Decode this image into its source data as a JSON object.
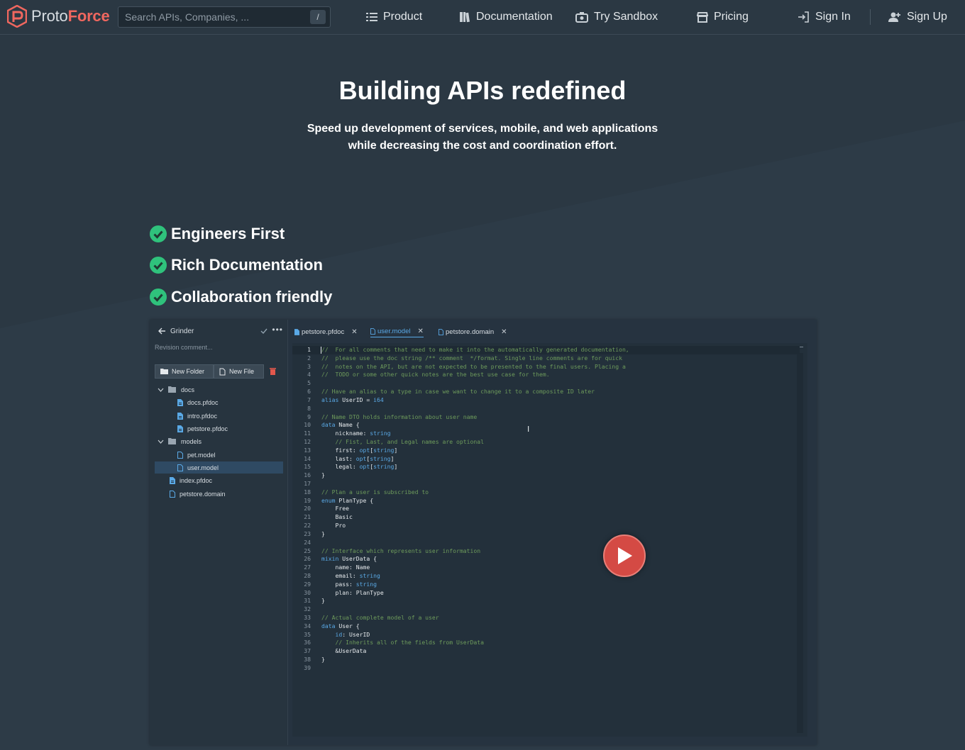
{
  "brand": {
    "proto": "Proto",
    "force": "Force"
  },
  "search": {
    "placeholder": "Search APIs, Companies, ...",
    "shortcut": "/"
  },
  "nav": {
    "product": "Product",
    "documentation": "Documentation",
    "sandbox": "Try Sandbox",
    "pricing": "Pricing",
    "signin": "Sign In",
    "signup": "Sign Up"
  },
  "hero": {
    "title": "Building APIs redefined",
    "subtitle_line1": "Speed up development of services, mobile, and web applications",
    "subtitle_line2": "while decreasing the cost and coordination effort."
  },
  "features": [
    "Engineers First",
    "Rich Documentation",
    "Collaboration friendly"
  ],
  "editor": {
    "project": "Grinder",
    "revision_placeholder": "Revision comment...",
    "new_folder": "New Folder",
    "new_file": "New File",
    "tree": [
      {
        "label": "docs"
      },
      {
        "label": "docs.pfdoc"
      },
      {
        "label": "intro.pfdoc"
      },
      {
        "label": "petstore.pfdoc"
      },
      {
        "label": "models"
      },
      {
        "label": "pet.model"
      },
      {
        "label": "user.model"
      },
      {
        "label": "index.pfdoc"
      },
      {
        "label": "petstore.domain"
      }
    ],
    "tabs": [
      {
        "label": "petstore.pfdoc"
      },
      {
        "label": "user.model"
      },
      {
        "label": "petstore.domain"
      }
    ],
    "code": [
      "//  For all comments that need to make it into the automatically generated documentation,",
      "//  please use the doc string /** comment  */format. Single line comments are for quick",
      "//  notes on the API, but are not expected to be presented to the final users. Placing a",
      "//  TODO or some other quick notes are the best use case for them.",
      "",
      "// Have an alias to a type in case we want to change it to a composite ID later",
      "alias UserID = i64",
      "",
      "// Name DTO holds information about user name",
      "data Name {",
      "    nickname: string",
      "    // Fist, Last, and Legal names are optional",
      "    first: opt[string]",
      "    last: opt[string]",
      "    legal: opt[string]",
      "}",
      "",
      "// Plan a user is subscribed to",
      "enum PlanType {",
      "    Free",
      "    Basic",
      "    Pro",
      "}",
      "",
      "// Interface which represents user information",
      "mixin UserData {",
      "    name: Name",
      "    email: string",
      "    pass: string",
      "    plan: PlanType",
      "}",
      "",
      "// Actual complete model of a user",
      "data User {",
      "    id: UserID",
      "    // Inherits all of the fields from UserData",
      "    &UserData",
      "}",
      ""
    ]
  }
}
